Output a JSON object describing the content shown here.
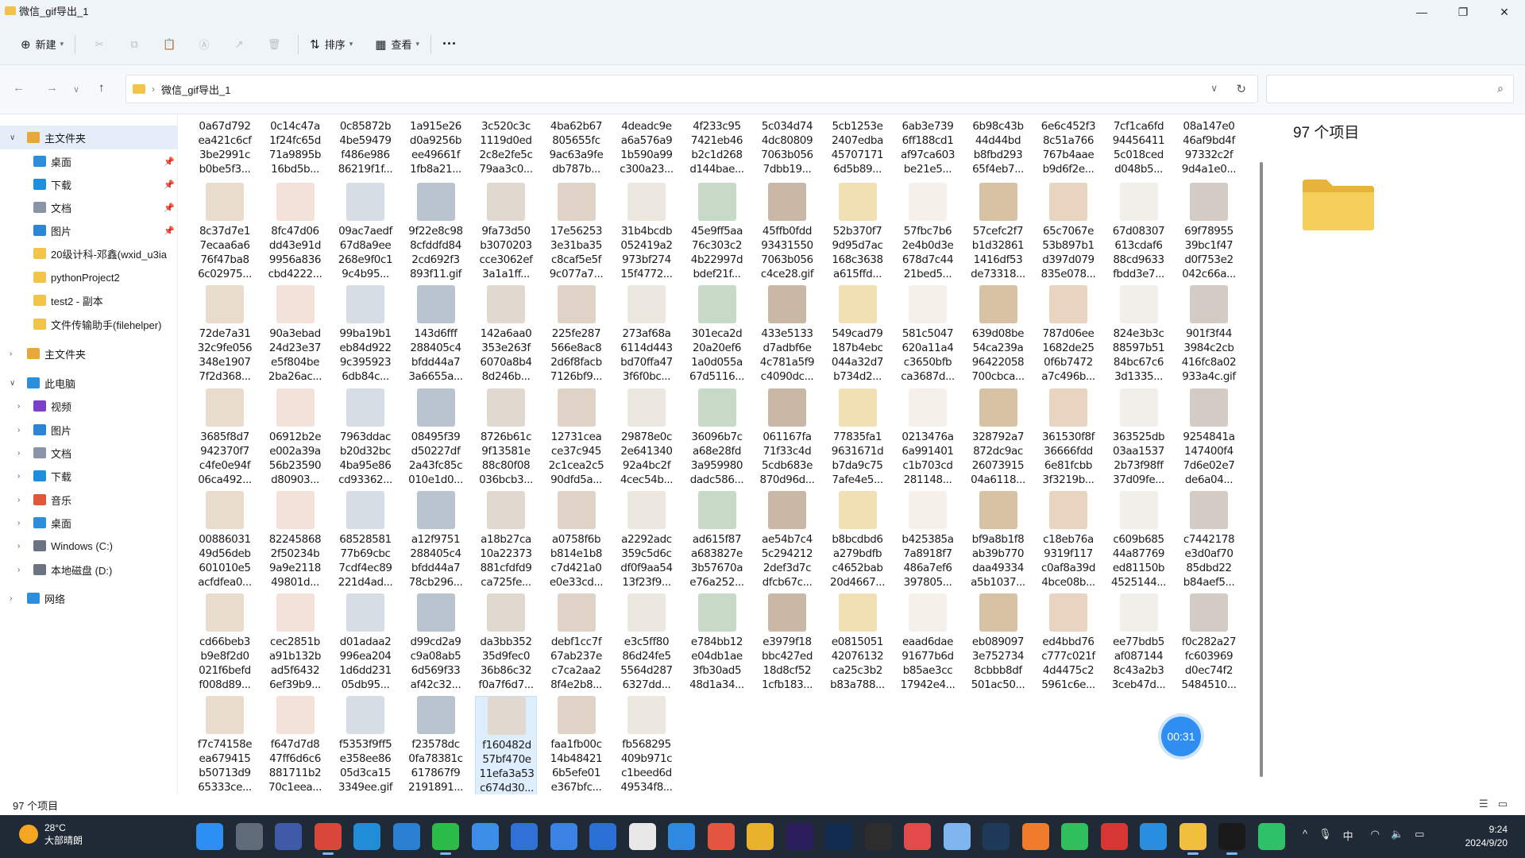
{
  "window": {
    "title": "微信_gif导出_1",
    "controls": [
      "minimize-icon",
      "maximize-icon",
      "close-icon"
    ]
  },
  "toolbar": {
    "new_label": "新建",
    "sort_label": "排序",
    "view_label": "查看",
    "more_label": "···",
    "disabled_actions": [
      "cut-icon",
      "copy-icon",
      "paste-icon",
      "rename-icon",
      "share-icon",
      "delete-icon"
    ]
  },
  "address": {
    "path": "微信_gif导出_1",
    "search_placeholder": ""
  },
  "sidebar": {
    "items": [
      {
        "label": "主文件夹",
        "icon": "home-icon",
        "color": "#e8a73a"
      },
      {
        "label": "桌面",
        "icon": "desktop-icon",
        "color": "#2c8fdc"
      },
      {
        "label": "下载",
        "icon": "download-icon",
        "color": "#1e8fdd"
      },
      {
        "label": "文档",
        "icon": "documents-icon",
        "color": "#8895a6"
      },
      {
        "label": "图片",
        "icon": "pictures-icon",
        "color": "#2c86d6"
      },
      {
        "label": "20级计科-邓鑫(wxid_u3ia",
        "icon": "folder-icon",
        "color": "#f3c34a"
      },
      {
        "label": "pythonProject2",
        "icon": "folder-icon",
        "color": "#f3c34a"
      },
      {
        "label": "test2 - 副本",
        "icon": "folder-icon",
        "color": "#f3c34a"
      },
      {
        "label": "文件传输助手(filehelper)",
        "icon": "folder-icon",
        "color": "#f3c34a"
      },
      {
        "label": "主文件夹",
        "icon": "home-icon",
        "color": "#e8a73a"
      },
      {
        "label": "此电脑",
        "icon": "computer-icon",
        "color": "#2c8fdc"
      },
      {
        "label": "视频",
        "icon": "videos-icon",
        "color": "#7b3fc9"
      },
      {
        "label": "图片",
        "icon": "pictures-icon",
        "color": "#2c86d6"
      },
      {
        "label": "文档",
        "icon": "documents-icon",
        "color": "#8895a6"
      },
      {
        "label": "下载",
        "icon": "download-icon",
        "color": "#1e8fdd"
      },
      {
        "label": "音乐",
        "icon": "music-icon",
        "color": "#e3563a"
      },
      {
        "label": "桌面",
        "icon": "desktop-icon",
        "color": "#2c8fdc"
      },
      {
        "label": "Windows (C:)",
        "icon": "drive-icon",
        "color": "#6b7480"
      },
      {
        "label": "本地磁盘 (D:)",
        "icon": "drive-icon",
        "color": "#6b7480"
      },
      {
        "label": "网络",
        "icon": "network-icon",
        "color": "#2c8fdc"
      }
    ]
  },
  "files": [
    "0a67d792 ea421c6cf 3be2991c b0be5f3...",
    "0c14c47a 1f24fc65d 71a9895b 16bd5b...",
    "0c85872b 4be59479 f486e986 86219f1f...",
    "1a915e26 d0a9256b ee49661f 1fb8a21...",
    "3c520c3c 1119d0ed 2c8e2fe5c 79aa3c0...",
    "4ba62b67 805655fc 9ac63a9fe db787b...",
    "4deadc9e a6a576a9 1b590a99 c300a23...",
    "4f233c95 7421eb46 b2c1d268 d144bae...",
    "5c034d74 4dc80809 7063b056 7dbb19...",
    "5cb1253e 2407edba 45707171 6d5b89...",
    "6ab3e739 6ff188cd1 af97ca603 be21e5...",
    "6b98c43b 44d44bd b8fbd293 65f4eb7...",
    "6e6c452f3 8c51a766 767b4aae b9d6f2e...",
    "7cf1ca6fd 94456411 5c018ced d048b5...",
    "08a147e0 46af9bd4f 97332c2f 9d4a1e0...",
    "8c37d7e1 7ecaa6a6 76f47ba8 6c02975...",
    "8fc47d06 dd43e91d 9956a836 cbd4222...",
    "09ac7aedf 67d8a9ee 268e9f0c1 9c4b95...",
    "9f22e8c98 8cfddfd84 2cd692f3 893f11.gif",
    "9fa73d50 b3070203 cce3062ef 3a1a1ff...",
    "17e56253 3e31ba35 c8caf5e5f 9c077a7...",
    "31b4bcdb 052419a2 973bf274 15f4772...",
    "45e9ff5aa 76c303c2 4b22997d bdef21f...",
    "45ffb0fdd 93431550 7063b056 c4ce28.gif",
    "52b370f7 9d95d7ac 168c3638 a615ffd...",
    "57fbc7b6 2e4b0d3e 678d7c44 21bed5...",
    "57cefc2f7 b1d32861 1416df53 de73318...",
    "65c7067e 53b897b1 d397d079 835e078...",
    "67d08307 613cdaf6 88cd9633 fbdd3e7...",
    "69f78955 39bc1f47 d0f753e2 042c66a...",
    "72de7a31 32c9fe056 348e1907 7f2d368...",
    "90a3ebad 24d23e37 e5f804be 2ba26ac...",
    "99ba19b1 eb84d922 9c395923 6db84c...",
    "143d6fff 288405c4 bfdd44a7 3a6655a...",
    "142a6aa0 353e263f 6070a8b4 8d246b...",
    "225fe287 566e8ac8 2d6f8facb 7126bf9...",
    "273af68a 6114d443 bd70ffa47 3f6f0bc...",
    "301eca2d 20a20ef6 1a0d055a 67d5116...",
    "433e5133 d7adbf6e 4c781a5f9 c4090dc...",
    "549cad79 187b4ebc 044a32d7 b734d2...",
    "581c5047 620a11a4 c3650bfb ca3687d...",
    "639d08be 54ca239a 96422058 700cbca...",
    "787d06ee 1682de25 0f6b7472 a7c496b...",
    "824e3b3c 88597b51 84bc67c6 3d1335...",
    "901f3f44 3984c2cb 416fc8a02 933a4c.gif",
    "3685f8d7 942370f7 c4fe0e94f 06ca492...",
    "06912b2e e002a39a 56b23590 d80903...",
    "7963ddac b20d32bc 4ba95e86 cd93362...",
    "08495f39 d50227df 2a43fc85c 010e1d0...",
    "8726b61c 9f13581e 88c80f08 036bcb3...",
    "12731cea ce37c945 2c1cea2c5 90dfd5a...",
    "29878e0c 2e641340 92a4bc2f 4cec54b...",
    "36096b7c a68e28fd 3a959980 dadc586...",
    "061167fa 71f33c4d 5cdb683e 870d96d...",
    "77835fa1 9631671d b7da9c75 7afe4e5...",
    "0213476a 6a991401 c1b703cd 281148...",
    "328792a7 872dc9ac 26073915 04a6118...",
    "361530f8f 36666fdd 6e81fcbb 3f3219b...",
    "363525db 03aa1537 2b73f98ff 37d09fe...",
    "9254841a 147400f4 7d6e02e7 de6a04...",
    "00886031 49d56deb 601010e5 acfdfea0...",
    "82245868 2f50234b 9a9e2118 49801d...",
    "68528581 77b69cbc 7cdf4ec89 221d4ad...",
    "a12f9751 288405c4 bfdd44a7 78cb296...",
    "a18b27ca 10a22373 881cfdfd9 ca725fe...",
    "a0758f6b b814e1b8 c7d421a0 e0e33cd...",
    "a2292adc 359c5d6c df0f9aa54 13f23f9...",
    "ad615f87 a683827e 3b57670a e76a252...",
    "ae54b7c4 5c294212 2def3d7c dfcb67c...",
    "b8bcdbd6 a279bdfb c4652bab 20d4667...",
    "b425385a 7a8918f7 486a7ef6 397805...",
    "bf9a8b1f8 ab39b770 daa49334 a5b1037...",
    "c18eb76a 9319f117 c0af8a39d 4bce08b...",
    "c609b685 44a87769 ed81150b 4525144...",
    "c7442178 e3d0af70 85dbd22 b84aef5...",
    "cd66beb3 b9e8f2d0 021f6befd f008d89...",
    "cec2851b a91b132b ad5f6432 6ef39b9...",
    "d01adaa2 996ea204 1d6dd231 05db95...",
    "d99cd2a9 c9a08ab5 6d569f33 af42c32...",
    "da3bb352 35d9fec0 36b86c32 f0a7f6d7...",
    "debf1cc7f 67ab237e c7ca2aa2 8f4e2b8...",
    "e3c5ff80 86d24fe5 5564d287 6327dd...",
    "e784bb12 e04db1ae 3fb30ad5 48d1a34...",
    "e3979f18 bbc427ed 18d8cf52 1cfb183...",
    "e0815051 42076132 ca25c3b2 b83a788...",
    "eaad6dae 91677b6d b85ae3cc 17942e4...",
    "eb089097 3e752734 8cbbb8df 501ac50...",
    "ed4bbd76 c777c021f 4d4475c2 5961c6e...",
    "ee77bdb5 af087144 8c43a2b3 3ceb47d...",
    "f0c282a27 fc603969 d0ec74f2 5484510...",
    "f7c74158e ea679415 b50713d9 65333ce...",
    "f647d7d8 47ff6d6c6 881711b2 70c1eea...",
    "f5353f9ff5 e358ee86 05d3ca15 3349ee.gif",
    "f23578dc 0fa78381c 617867f9 2191891...",
    "f160482d 57bf470e 11efa3a53 c674d30...",
    "faa1fb00c 14b48421 6b5efe01 e367bfc...",
    "fb568295 409b971c c1beed6d 49534f8..."
  ],
  "thumb_colors": [
    "#e9dccd",
    "#f1efe9",
    "#d8c2a4",
    "#f0e0b4",
    "#c7d9c7",
    "#dfd2c6",
    "#b9c4cf",
    "#f3e2da",
    "#d4ccc4",
    "#e8d4c0",
    "#f5f1ea",
    "#c9b8a6",
    "#ece7df",
    "#e1d9cf",
    "#d6dde4"
  ],
  "details": {
    "count": "97 个项目"
  },
  "timer": "00:31",
  "status": {
    "count": "97 个项目"
  },
  "taskbar": {
    "weather_temp": "28°C",
    "weather_desc": "大部晴朗",
    "apps": [
      {
        "name": "start-icon",
        "color": "#2b8ff3"
      },
      {
        "name": "task-view-icon",
        "color": "#5f6b78"
      },
      {
        "name": "app-icon-1",
        "color": "#3f5aa8"
      },
      {
        "name": "chrome-icon",
        "color": "#d9473b"
      },
      {
        "name": "edge-icon",
        "color": "#1f8ed6"
      },
      {
        "name": "app-icon-2",
        "color": "#2a7fd1"
      },
      {
        "name": "wechat-icon",
        "color": "#2bbb49"
      },
      {
        "name": "app-icon-3",
        "color": "#3d8ee8"
      },
      {
        "name": "app-icon-4",
        "color": "#2f71d6"
      },
      {
        "name": "app-icon-5",
        "color": "#3b82e6"
      },
      {
        "name": "app-icon-6",
        "color": "#2a6fd6"
      },
      {
        "name": "app-icon-7",
        "color": "#e8e8e8"
      },
      {
        "name": "app-icon-8",
        "color": "#2d8ae0"
      },
      {
        "name": "app-icon-9",
        "color": "#e4543e"
      },
      {
        "name": "app-icon-10",
        "color": "#e8b32a"
      },
      {
        "name": "premiere-icon",
        "color": "#2a1f5c"
      },
      {
        "name": "photoshop-icon",
        "color": "#0f2c4f"
      },
      {
        "name": "app-icon-11",
        "color": "#2d2d2d"
      },
      {
        "name": "app-icon-12",
        "color": "#e44a4a"
      },
      {
        "name": "app-icon-13",
        "color": "#7fb6f0"
      },
      {
        "name": "steam-icon",
        "color": "#1d3a5a"
      },
      {
        "name": "app-icon-14",
        "color": "#f07b2a"
      },
      {
        "name": "app-icon-15",
        "color": "#2fbf5c"
      },
      {
        "name": "app-icon-16",
        "color": "#d83535"
      },
      {
        "name": "app-icon-17",
        "color": "#2a8ee0"
      },
      {
        "name": "file-explorer-icon",
        "color": "#f0bf3c"
      },
      {
        "name": "pycharm-icon",
        "color": "#1a1a1a"
      },
      {
        "name": "app-icon-18",
        "color": "#2fc06a"
      }
    ],
    "tray_ime": "中",
    "time": "9:24",
    "date": "2024/9/20"
  }
}
